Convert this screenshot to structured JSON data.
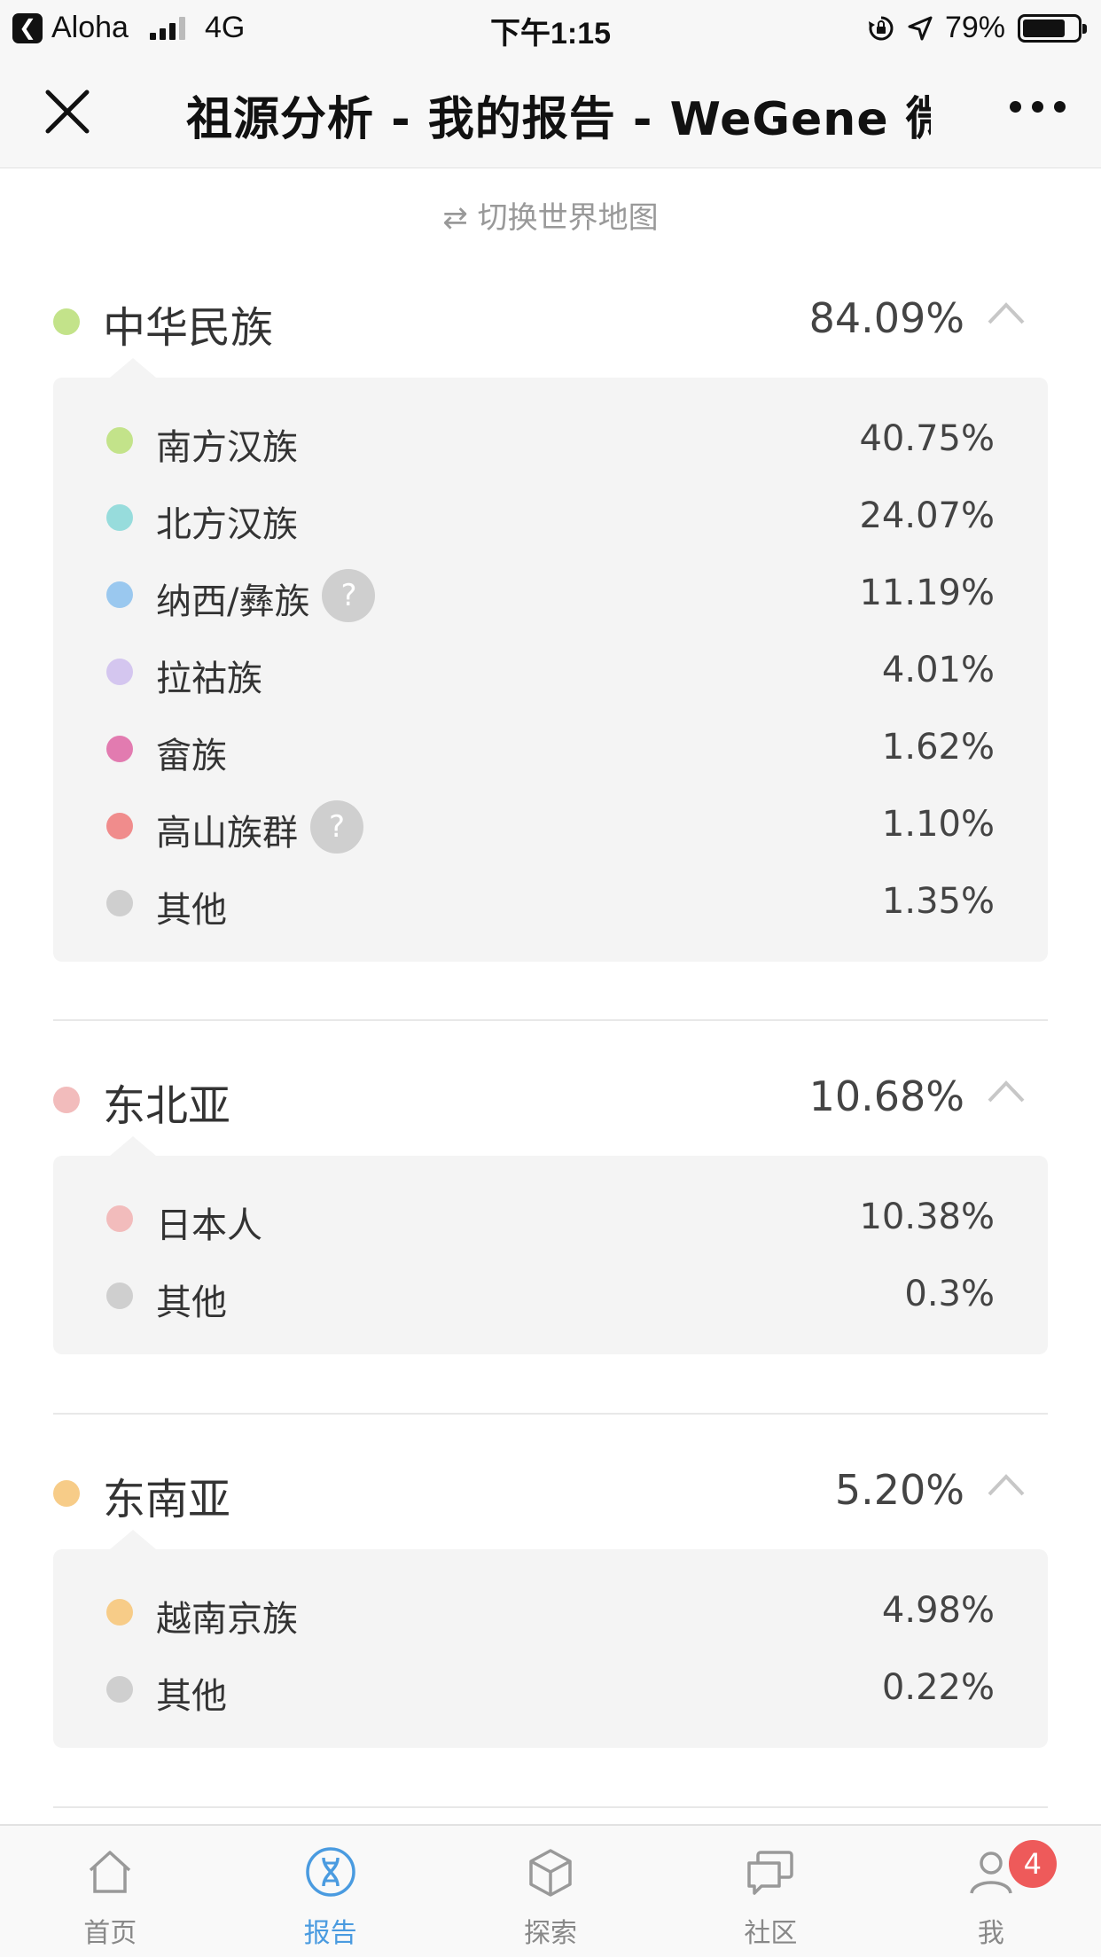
{
  "status_bar": {
    "carrier": "Aloha",
    "network": "4G",
    "time": "下午1:15",
    "battery": "79%",
    "battery_level": 0.79
  },
  "nav": {
    "title": "祖源分析 - 我的报告 - WeGene 微"
  },
  "switch_map": "⇄ 切换世界地图",
  "sections": [
    {
      "name": "中华民族",
      "percent": "84.09%",
      "color": "#c3e38a",
      "items": [
        {
          "name": "南方汉族",
          "percent": "40.75%",
          "color": "#c3e38a",
          "help": false
        },
        {
          "name": "北方汉族",
          "percent": "24.07%",
          "color": "#97dcdc",
          "help": false
        },
        {
          "name": "纳西/彝族",
          "percent": "11.19%",
          "color": "#9ac8ef",
          "help": true
        },
        {
          "name": "拉祜族",
          "percent": "4.01%",
          "color": "#d4c6ef",
          "help": false
        },
        {
          "name": "畲族",
          "percent": "1.62%",
          "color": "#e27bb0",
          "help": false
        },
        {
          "name": "高山族群",
          "percent": "1.10%",
          "color": "#f08c8c",
          "help": true
        },
        {
          "name": "其他",
          "percent": "1.35%",
          "color": "#cfcfcf",
          "help": false
        }
      ]
    },
    {
      "name": "东北亚",
      "percent": "10.68%",
      "color": "#f2bcbc",
      "items": [
        {
          "name": "日本人",
          "percent": "10.38%",
          "color": "#f2bcbc",
          "help": false
        },
        {
          "name": "其他",
          "percent": "0.3%",
          "color": "#cfcfcf",
          "help": false
        }
      ]
    },
    {
      "name": "东南亚",
      "percent": "5.20%",
      "color": "#f7cc88",
      "items": [
        {
          "name": "越南京族",
          "percent": "4.98%",
          "color": "#f7cc88",
          "help": false
        },
        {
          "name": "其他",
          "percent": "0.22%",
          "color": "#cfcfcf",
          "help": false
        }
      ]
    }
  ],
  "help_glyph": "?",
  "tabs": [
    {
      "label": "首页",
      "icon": "home-icon"
    },
    {
      "label": "报告",
      "icon": "dna-icon",
      "active": true
    },
    {
      "label": "探索",
      "icon": "cube-icon"
    },
    {
      "label": "社区",
      "icon": "chat-icon"
    },
    {
      "label": "我",
      "icon": "user-icon",
      "badge": "4"
    }
  ]
}
